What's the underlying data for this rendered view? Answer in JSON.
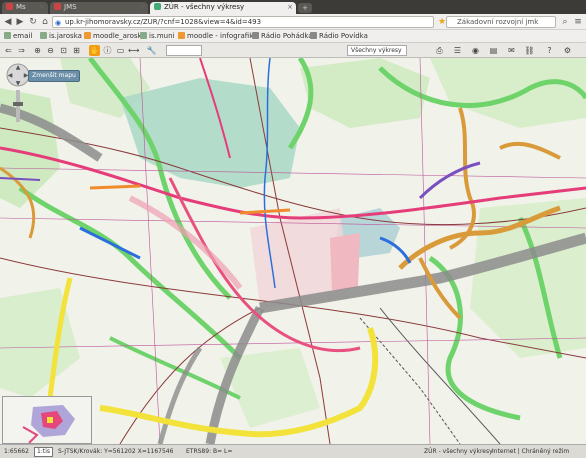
{
  "browser": {
    "tabs": [
      {
        "label": "Ms",
        "active": false
      },
      {
        "label": "JMS",
        "active": false
      },
      {
        "label": "ZÚR - všechny výkresy",
        "active": true
      }
    ],
    "url_site": "",
    "url": "up.kr-jihomoravsky.cz/ZUR/?cnf=1028&view=4&id=493",
    "search_placeholder": "Zákadovní rozvojní jmk",
    "bookmarks": [
      "email",
      "is.jaroska",
      "moodle_aroska",
      "is.muni",
      "moodle - infografika",
      "Rádio Pohádka",
      "Rádio Povídka"
    ]
  },
  "map": {
    "pan_button_label": "Zmenšit mapu",
    "tool_dropdown": "Všechny výkresy"
  },
  "status": {
    "scale": "1:65662",
    "scale_btn": "1:tis",
    "coords": "S-JTSK/Krovák: Y=561202 X=1167546",
    "etrs": "ETRS89: B= L=",
    "title": "ZÚR - všechny výkresy",
    "zone": "Internet | Chráněný režim"
  }
}
